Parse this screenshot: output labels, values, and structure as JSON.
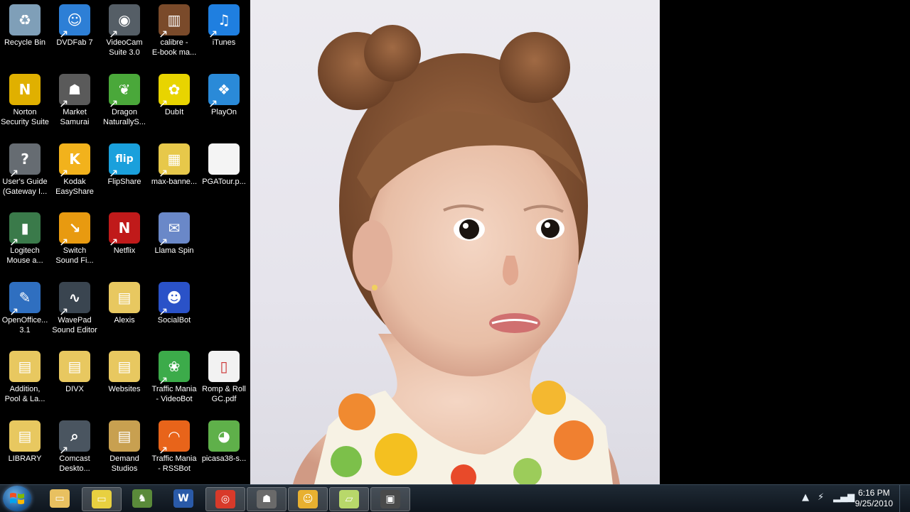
{
  "desktop": {
    "icons": [
      {
        "label": "Recycle Bin",
        "glyph": "♻",
        "color": "#7f9fb8",
        "shortcut": false
      },
      {
        "label": "DVDFab 7",
        "glyph": "☺",
        "color": "#2d7fd6",
        "shortcut": true
      },
      {
        "label": "VideoCam\nSuite 3.0",
        "glyph": "◉",
        "color": "#555e66",
        "shortcut": true
      },
      {
        "label": "calibre -\nE-book ma...",
        "glyph": "▥",
        "color": "#7a4a2a",
        "shortcut": true
      },
      {
        "label": "iTunes",
        "glyph": "♫",
        "color": "#1f7fe0",
        "shortcut": true
      },
      {
        "label": "Norton\nSecurity Suite",
        "glyph": "N",
        "color": "#e0b000",
        "shortcut": false
      },
      {
        "label": "Market\nSamurai",
        "glyph": "☗",
        "color": "#5a5a5a",
        "shortcut": true
      },
      {
        "label": "Dragon\nNaturallyS...",
        "glyph": "❦",
        "color": "#4aa83a",
        "shortcut": true
      },
      {
        "label": "DubIt",
        "glyph": "✿",
        "color": "#e8d400",
        "shortcut": true
      },
      {
        "label": "PlayOn",
        "glyph": "❖",
        "color": "#2a8ad8",
        "shortcut": true
      },
      {
        "label": "User's Guide\n(Gateway I...",
        "glyph": "?",
        "color": "#666c72",
        "shortcut": true
      },
      {
        "label": "Kodak\nEasyShare",
        "glyph": "K",
        "color": "#f2b21c",
        "shortcut": true
      },
      {
        "label": "FlipShare",
        "glyph": "flip",
        "color": "#1aa0dc",
        "shortcut": true
      },
      {
        "label": "max-banne...",
        "glyph": "▦",
        "color": "#e7c84a",
        "shortcut": true
      },
      {
        "label": "PGATour.p...",
        "glyph": "",
        "color": "#f4f4f4",
        "shortcut": false
      },
      {
        "label": "Logitech\nMouse a...",
        "glyph": "▮",
        "color": "#3a7a4a",
        "shortcut": true
      },
      {
        "label": "Switch\nSound Fi...",
        "glyph": "↘",
        "color": "#e89a10",
        "shortcut": true
      },
      {
        "label": "Netflix",
        "glyph": "N",
        "color": "#c01a1a",
        "shortcut": true
      },
      {
        "label": "Llama Spin",
        "glyph": "✉",
        "color": "#6a88c8",
        "shortcut": true
      },
      {
        "label": "OpenOffice...\n3.1",
        "glyph": "✎",
        "color": "#2f6fc0",
        "shortcut": true
      },
      {
        "label": "WavePad\nSound Editor",
        "glyph": "∿",
        "color": "#3a4550",
        "shortcut": true
      },
      {
        "label": "Alexis",
        "glyph": "▤",
        "color": "#e8c860",
        "shortcut": false
      },
      {
        "label": "SocialBot",
        "glyph": "☻",
        "color": "#2a52c8",
        "shortcut": true
      },
      {
        "label": "Addition,\nPool & La...",
        "glyph": "▤",
        "color": "#e8c860",
        "shortcut": false
      },
      {
        "label": "DIVX",
        "glyph": "▤",
        "color": "#e8c860",
        "shortcut": false
      },
      {
        "label": "Websites",
        "glyph": "▤",
        "color": "#e8c860",
        "shortcut": false
      },
      {
        "label": "Traffic Mania\n- VideoBot",
        "glyph": "❀",
        "color": "#3cab4a",
        "shortcut": true
      },
      {
        "label": "Romp & Roll\nGC.pdf",
        "glyph": "▯",
        "color": "#f2f2f2",
        "shortcut": false
      },
      {
        "label": "LIBRARY",
        "glyph": "▤",
        "color": "#e8c860",
        "shortcut": false
      },
      {
        "label": "Comcast\nDeskto...",
        "glyph": "⌕",
        "color": "#4a5560",
        "shortcut": true
      },
      {
        "label": "Demand\nStudios",
        "glyph": "▤",
        "color": "#c8a050",
        "shortcut": false
      },
      {
        "label": "Traffic Mania\n- RSSBot",
        "glyph": "◠",
        "color": "#e8641a",
        "shortcut": true
      },
      {
        "label": "picasa38-s...",
        "glyph": "◕",
        "color": "#5fb04a",
        "shortcut": false
      }
    ]
  },
  "taskbar": {
    "pinned": [
      {
        "name": "windows-explorer-button",
        "glyph": "▭",
        "color": "#e8c060",
        "active": false
      },
      {
        "name": "app-folder-button",
        "glyph": "▭",
        "color": "#e8d040",
        "active": true
      },
      {
        "name": "evernote-button",
        "glyph": "♞",
        "color": "#5a8a3a",
        "active": false
      },
      {
        "name": "word-button",
        "glyph": "W",
        "color": "#2a5aa8",
        "active": false
      },
      {
        "name": "chrome-button",
        "glyph": "◎",
        "color": "#d83a2a",
        "active": true
      },
      {
        "name": "market-samurai-button",
        "glyph": "☗",
        "color": "#6a6a6a",
        "active": true
      },
      {
        "name": "sticky-app-button",
        "glyph": "☺",
        "color": "#e8b030",
        "active": true
      },
      {
        "name": "notes-button",
        "glyph": "▱",
        "color": "#b8d86a",
        "active": true
      },
      {
        "name": "recorder-button",
        "glyph": "▣",
        "color": "#4a4a4a",
        "active": true
      }
    ],
    "tray": {
      "time": "6:16 PM",
      "date": "9/25/2010"
    }
  }
}
